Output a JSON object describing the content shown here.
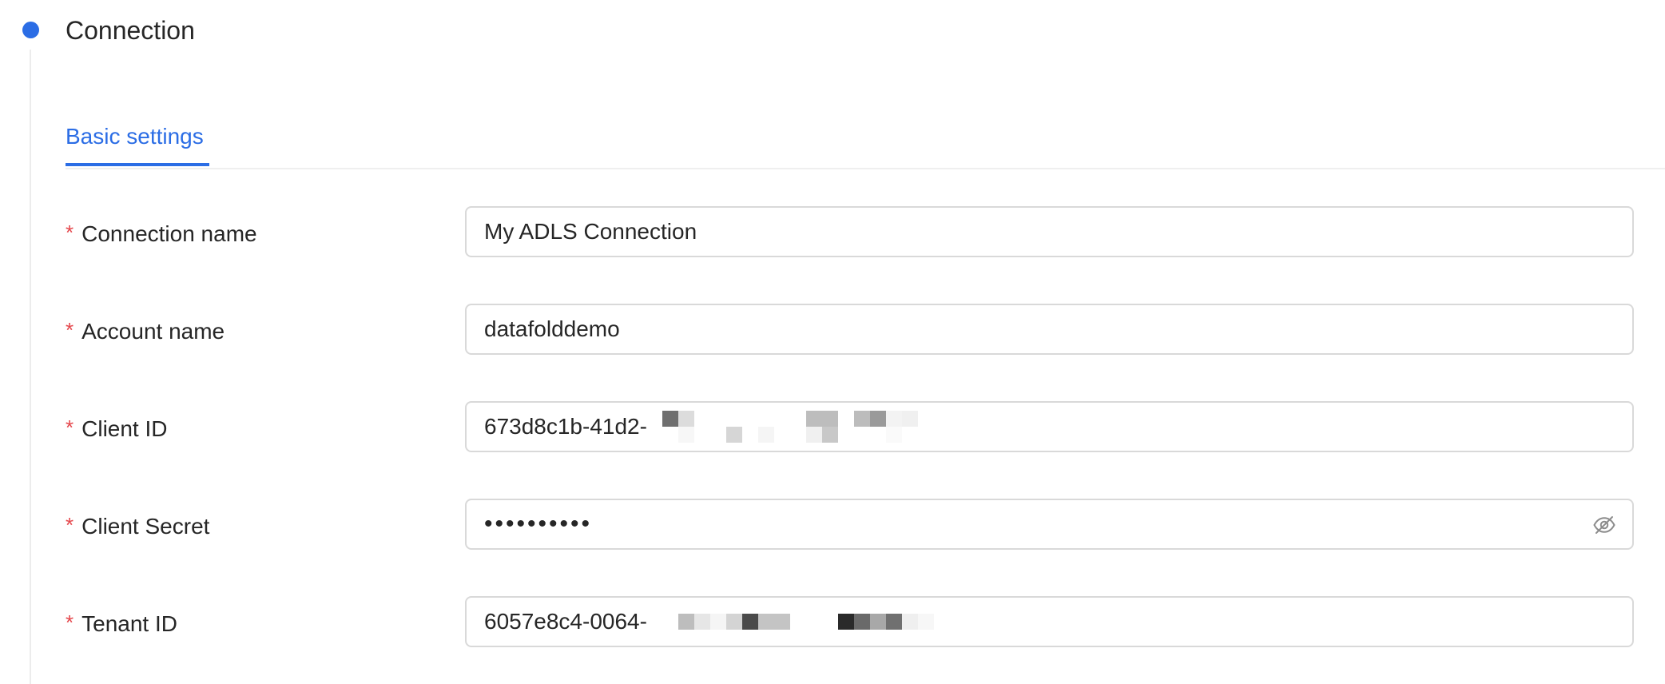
{
  "section": {
    "title": "Connection"
  },
  "tabs": [
    {
      "label": "Basic settings",
      "active": true
    }
  ],
  "fields": {
    "connection_name": {
      "label": "Connection name",
      "required": true,
      "value": "My ADLS Connection"
    },
    "account_name": {
      "label": "Account name",
      "required": true,
      "value": "datafolddemo"
    },
    "client_id": {
      "label": "Client ID",
      "required": true,
      "value": "673d8c1b-41d2-",
      "redacted": true
    },
    "client_secret": {
      "label": "Client Secret",
      "required": true,
      "masked_value": "••••••••••",
      "toggle_icon": "eye-slash-icon"
    },
    "tenant_id": {
      "label": "Tenant ID",
      "required": true,
      "value": "6057e8c4-0064-",
      "redacted": true
    }
  },
  "required_marker": "*",
  "colors": {
    "accent": "#2b6de5",
    "required": "#e5484d",
    "border": "#d9d9d9",
    "text": "#262626"
  }
}
